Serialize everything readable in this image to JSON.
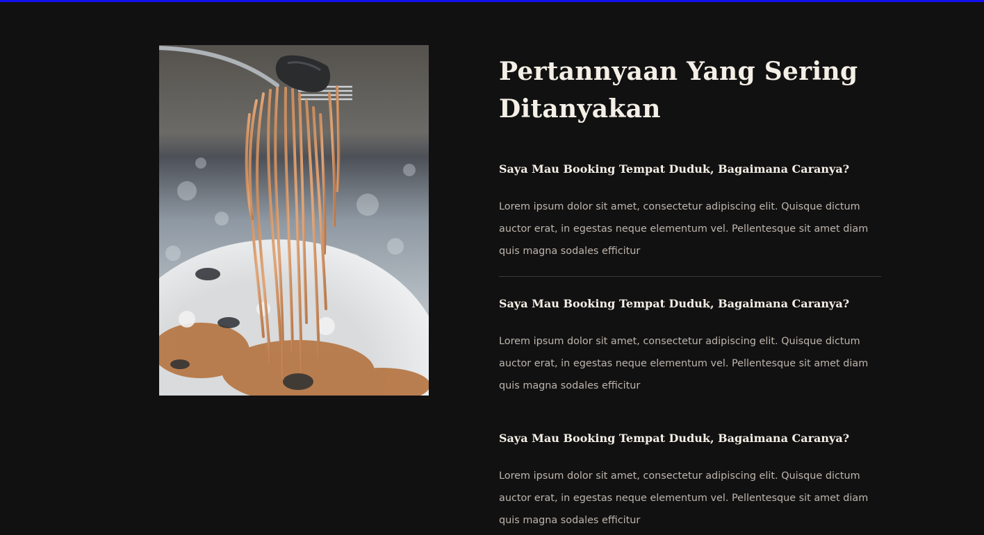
{
  "colors": {
    "background": "#121112",
    "top_bar": "#1010f0",
    "heading": "#f4efe6",
    "body_text": "#bdb6ad",
    "divider": "#3a3838"
  },
  "image": {
    "icon": "spaghetti-on-fork-photo"
  },
  "faq": {
    "title": "Pertannyaan Yang Sering Ditanyakan",
    "items": [
      {
        "question": "Saya Mau Booking Tempat Duduk, Bagaimana Caranya?",
        "answer": "Lorem ipsum dolor sit amet, consectetur adipiscing elit. Quisque dictum auctor erat, in egestas neque elementum vel. Pellentesque sit amet diam quis magna sodales efficitur"
      },
      {
        "question": "Saya Mau Booking Tempat Duduk, Bagaimana Caranya?",
        "answer": "Lorem ipsum dolor sit amet, consectetur adipiscing elit. Quisque dictum auctor erat, in egestas neque elementum vel. Pellentesque sit amet diam quis magna sodales efficitur"
      },
      {
        "question": "Saya Mau Booking Tempat Duduk, Bagaimana Caranya?",
        "answer": "Lorem ipsum dolor sit amet, consectetur adipiscing elit. Quisque dictum auctor erat, in egestas neque elementum vel. Pellentesque sit amet diam quis magna sodales efficitur"
      }
    ]
  }
}
